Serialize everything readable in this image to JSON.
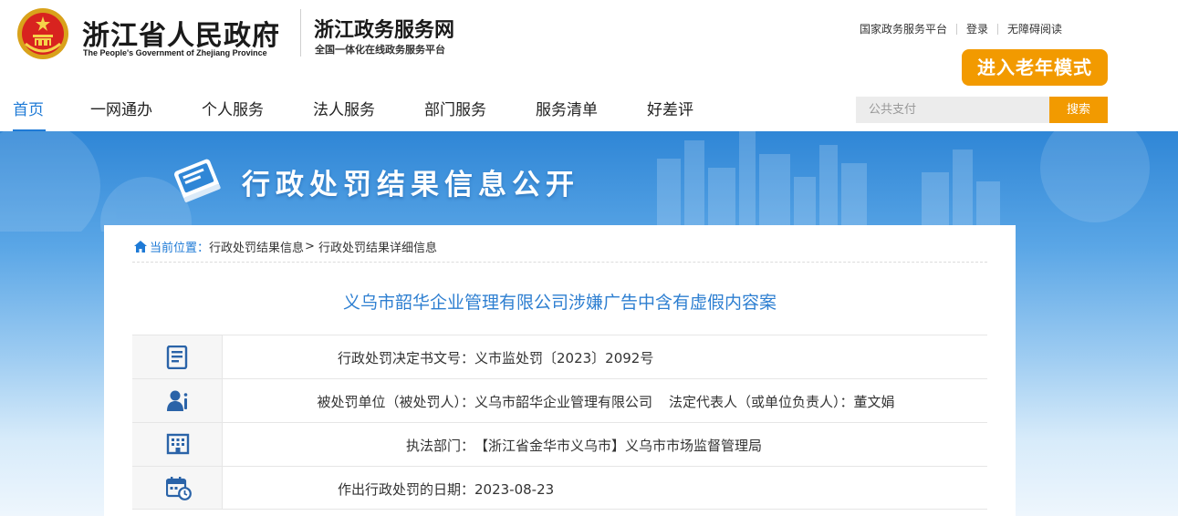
{
  "header": {
    "gov_title": "浙江省人民政府",
    "gov_subtitle": "The People's Government of Zhejiang Province",
    "service_title": "浙江政务服务网",
    "service_subtitle": "全国一体化在线政务服务平台",
    "top_links": [
      "国家政务服务平台",
      "登录",
      "无障碍阅读"
    ],
    "elder_mode_label": "进入老年模式"
  },
  "nav": {
    "items": [
      "首页",
      "一网通办",
      "个人服务",
      "法人服务",
      "部门服务",
      "服务清单",
      "好差评"
    ],
    "active_index": 0,
    "search_placeholder": "公共支付",
    "search_button": "搜索"
  },
  "banner": {
    "title": "行政处罚结果信息公开"
  },
  "breadcrumb": {
    "home": "当前位置：",
    "items": [
      "行政处罚结果信息",
      "行政处罚结果详细信息"
    ],
    "separator": ">"
  },
  "document": {
    "title": "义乌市韶华企业管理有限公司涉嫌广告中含有虚假内容案",
    "rows": [
      {
        "icon": "document-list-icon",
        "label": "行政处罚决定书文号：",
        "value": "义市监处罚〔2023〕2092号"
      },
      {
        "icon": "person-icon",
        "label": "被处罚单位（被处罚人）：",
        "value": "义乌市韶华企业管理有限公司",
        "label2": "法定代表人（或单位负责人）：",
        "value2": "董文娟"
      },
      {
        "icon": "building-icon",
        "label": "执法部门：",
        "value": "【浙江省金华市义乌市】义乌市市场监督管理局"
      },
      {
        "icon": "calendar-clock-icon",
        "label": "作出行政处罚的日期：",
        "value": "2023-08-23"
      }
    ]
  },
  "colors": {
    "accent_blue": "#1e7ad6",
    "title_blue": "#2e7fd1",
    "orange": "#f29a00"
  }
}
